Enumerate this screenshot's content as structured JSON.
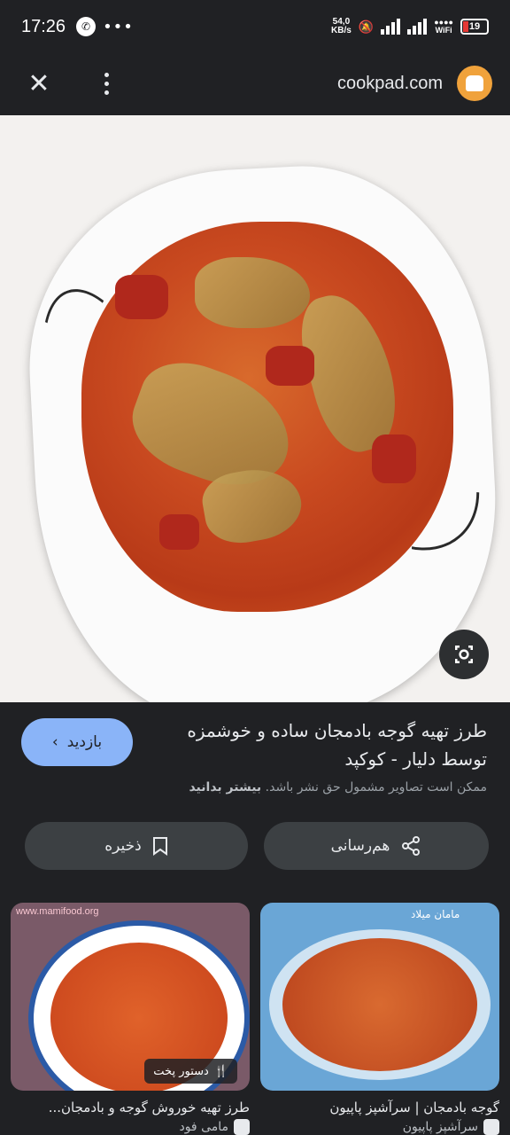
{
  "status": {
    "time": "17:26",
    "speed_value": "54,0",
    "speed_unit": "KB/s",
    "wifi": "WiFi",
    "battery": "19"
  },
  "viewer": {
    "domain": "cookpad.com"
  },
  "result": {
    "title": "طرز تهیه گوجه بادمجان ساده و خوشمزه توسط دلیار - کوکپد",
    "visit_label": "بازدید",
    "copyright_text": "ممکن است تصاویر مشمول حق نشر باشد.",
    "learn_more": "بیشتر بدانید",
    "share_label": "هم‌رسانی",
    "save_label": "ذخیره"
  },
  "related": [
    {
      "caption": "طرز تهیه خوروش گوجه و بادمجان...",
      "source": "مامی فود",
      "badge": "دستور پخت",
      "watermark": "www.mamifood.org"
    },
    {
      "caption": "گوجه بادمجان | سرآشپز پاپیون",
      "source": "سرآشپز پاپیون",
      "watermark": "مامان میلاد"
    }
  ],
  "icons": {
    "close": "close-icon",
    "more": "more-vert-icon",
    "lens": "lens-icon",
    "share": "share-icon",
    "save": "bookmark-icon",
    "chevron": "chevron-left-icon"
  },
  "colors": {
    "accent": "#8ab4f8",
    "favicon": "#f0a23b",
    "surface": "#3c4043"
  }
}
